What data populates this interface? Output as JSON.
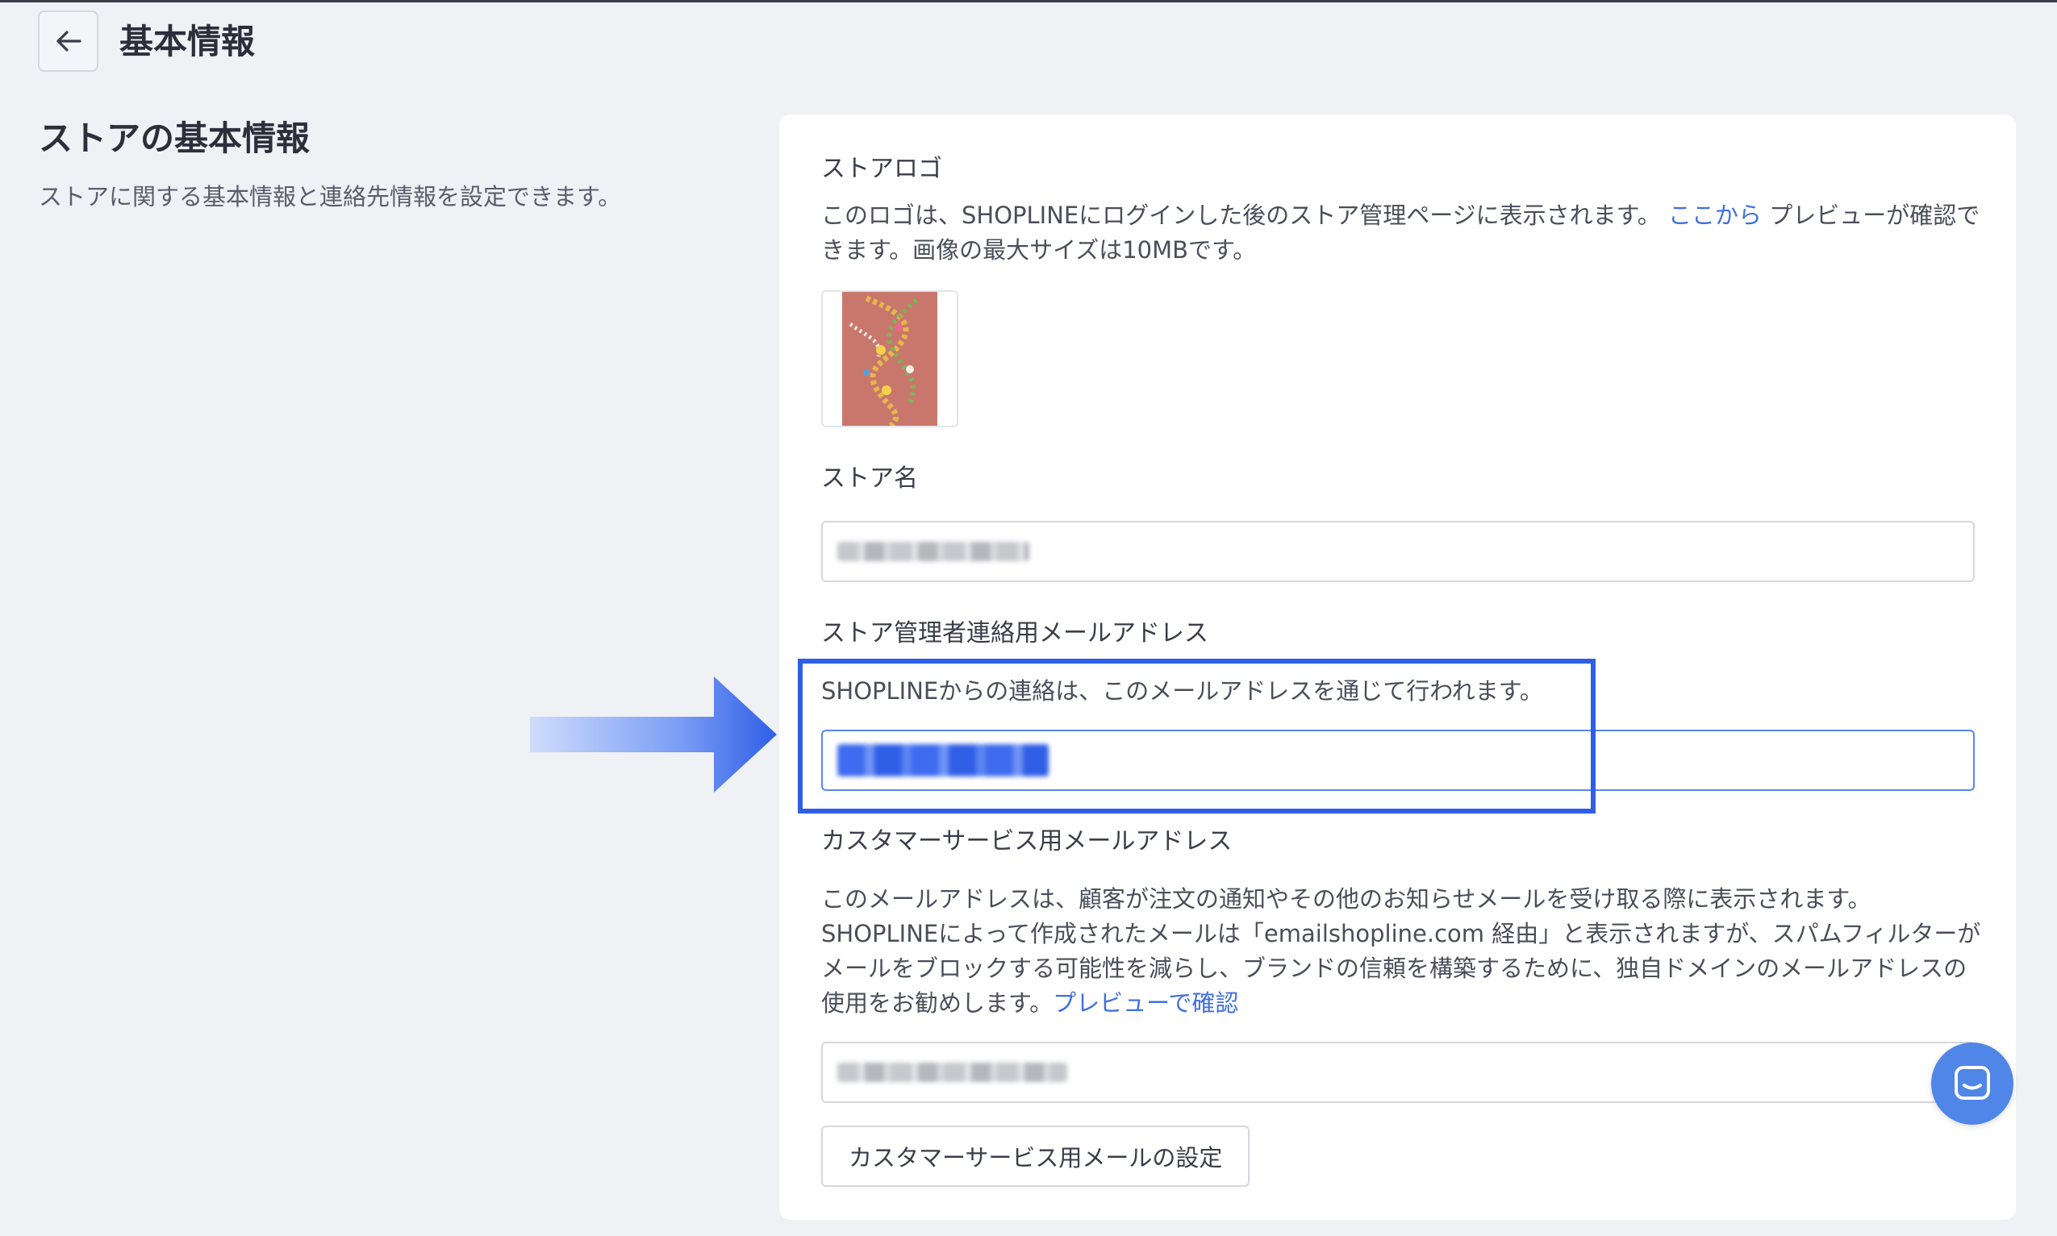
{
  "header": {
    "back_icon": "arrow-left-icon",
    "title": "基本情報"
  },
  "section": {
    "title": "ストアの基本情報",
    "description": "ストアに関する基本情報と連絡先情報を設定できます。"
  },
  "logo": {
    "label": "ストアロゴ",
    "desc_before_link": "このロゴは、SHOPLINEにログインした後のストア管理ページに表示されます。",
    "link_text": "ここから",
    "desc_after_link": " プレビューが確認できます。画像の最大サイズは10MBです。"
  },
  "store_name": {
    "label": "ストア名"
  },
  "admin_email": {
    "label": "ストア管理者連絡用メールアドレス",
    "description": "SHOPLINEからの連絡は、このメールアドレスを通じて行われます。"
  },
  "cs_email": {
    "label": "カスタマーサービス用メールアドレス",
    "desc_before_link": "このメールアドレスは、顧客が注文の通知やその他のお知らせメールを受け取る際に表示されます。SHOPLINEによって作成されたメールは「emailshopline.com 経由」と表示されますが、スパムフィルターがメールをブロックする可能性を減らし、ブランドの信頼を構築するために、独自ドメインのメールアドレスの使用をお勧めします。",
    "link_text": "プレビューで確認",
    "button_label": "カスタマーサービス用メールの設定"
  },
  "chat": {
    "icon": "chat-bubble-icon"
  },
  "colors": {
    "accent": "#2f5fe6",
    "link": "#3f6fe0",
    "chat": "#4f86e8"
  }
}
